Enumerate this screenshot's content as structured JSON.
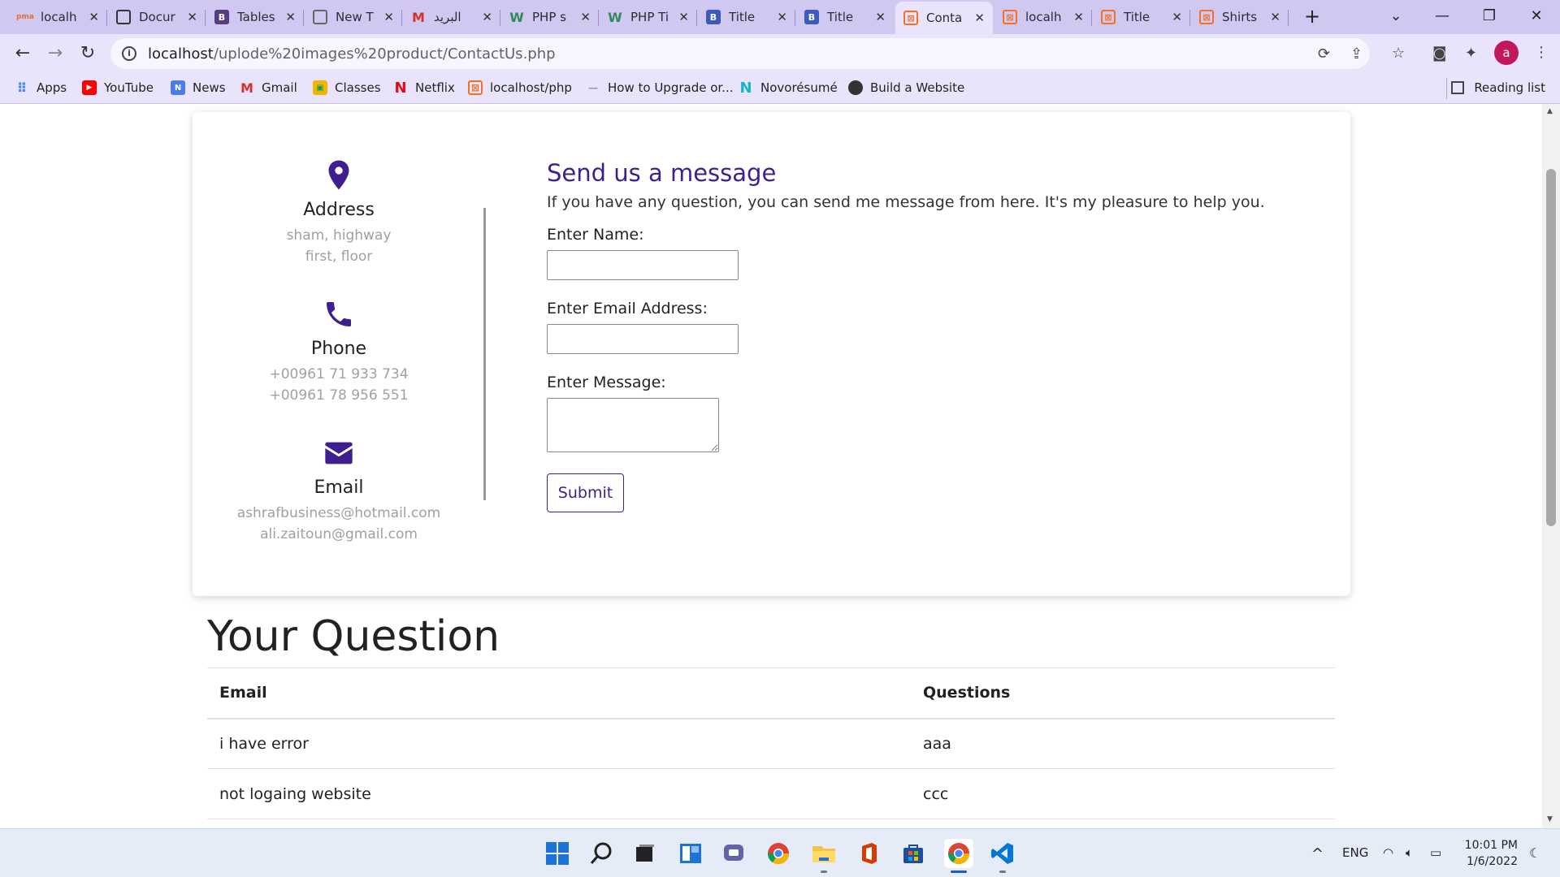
{
  "browser": {
    "tabs": [
      {
        "label": "localh",
        "icon": "phpmyadmin-icon",
        "active": false
      },
      {
        "label": "Docur",
        "icon": "globe-icon",
        "active": false
      },
      {
        "label": "Tables",
        "icon": "bootstrap-icon",
        "active": false
      },
      {
        "label": "New T",
        "icon": "chrome-newtab-icon",
        "active": false
      },
      {
        "label": "البريد",
        "icon": "gmail-icon",
        "active": false
      },
      {
        "label": "PHP s",
        "icon": "w3schools-icon",
        "active": false
      },
      {
        "label": "PHP Ti",
        "icon": "w3schools-icon",
        "active": false
      },
      {
        "label": "Title",
        "icon": "doc-icon",
        "active": false
      },
      {
        "label": "Title",
        "icon": "doc-icon",
        "active": false
      },
      {
        "label": "Conta",
        "icon": "xampp-icon",
        "active": true
      },
      {
        "label": "localh",
        "icon": "xampp-icon",
        "active": false
      },
      {
        "label": "Title",
        "icon": "xampp-icon",
        "active": false
      },
      {
        "label": "Shirts",
        "icon": "xampp-icon",
        "active": false
      }
    ],
    "url_host": "localhost",
    "url_path": "/uplode%20images%20product/ContactUs.php",
    "profile_initial": "a",
    "bookmarks": [
      {
        "label": "Apps",
        "icon": "apps-grid-icon"
      },
      {
        "label": "YouTube",
        "icon": "youtube-icon"
      },
      {
        "label": "News",
        "icon": "news-icon"
      },
      {
        "label": "Gmail",
        "icon": "gmail-icon"
      },
      {
        "label": "Classes",
        "icon": "classroom-icon"
      },
      {
        "label": "Netflix",
        "icon": "netflix-icon"
      },
      {
        "label": "localhost/php",
        "icon": "xampp-icon"
      },
      {
        "label": "How to Upgrade or...",
        "icon": "dash-icon"
      },
      {
        "label": "Novorésumé",
        "icon": "novoresume-icon"
      },
      {
        "label": "Build a Website",
        "icon": "globe-icon"
      }
    ],
    "reading_list": "Reading list"
  },
  "contact": {
    "address": {
      "title": "Address",
      "lines": [
        "sham, highway",
        "first, floor"
      ]
    },
    "phone": {
      "title": "Phone",
      "lines": [
        "+00961 71 933 734",
        "+00961 78 956 551"
      ]
    },
    "email": {
      "title": "Email",
      "lines": [
        "ashrafbusiness@hotmail.com",
        "ali.zaitoun@gmail.com"
      ]
    },
    "form": {
      "title": "Send us a message",
      "subtitle": "If you have any question, you can send me message from here. It's my pleasure to help you.",
      "name_label": "Enter Name:",
      "email_label": "Enter Email Address:",
      "message_label": "Enter Message:",
      "name_value": "",
      "email_value": "",
      "message_value": "",
      "submit_label": "Submit"
    }
  },
  "questions": {
    "heading": "Your Question",
    "columns": [
      "Email",
      "Questions"
    ],
    "rows": [
      [
        "i have error",
        "aaa"
      ],
      [
        "not logaing website",
        "ccc"
      ]
    ]
  },
  "taskbar": {
    "language": "ENG",
    "time": "10:01 PM",
    "date": "1/6/2022"
  },
  "colors": {
    "accent": "#3f1f8f",
    "tabbar": "#d1c8f2",
    "toolbar": "#e9e4fb"
  }
}
